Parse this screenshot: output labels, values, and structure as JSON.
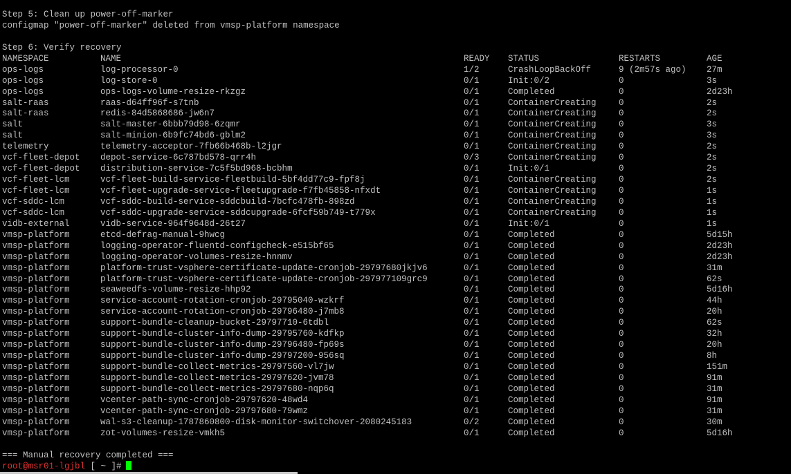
{
  "colors": {
    "background": "#000000",
    "text": "#c0c0c0",
    "prompt_user": "#e03030",
    "cursor": "#00ff00"
  },
  "header_lines": [
    "Step 5: Clean up power-off-marker",
    "configmap \"power-off-marker\" deleted from vmsp-platform namespace",
    "",
    "Step 6: Verify recovery"
  ],
  "table": {
    "columns": [
      "NAMESPACE",
      "NAME",
      "READY",
      "STATUS",
      "RESTARTS",
      "AGE"
    ],
    "rows": [
      [
        "ops-logs",
        "log-processor-0",
        "1/2",
        "CrashLoopBackOff",
        "9 (2m57s ago)",
        "27m"
      ],
      [
        "ops-logs",
        "log-store-0",
        "0/1",
        "Init:0/2",
        "0",
        "3s"
      ],
      [
        "ops-logs",
        "ops-logs-volume-resize-rkzgz",
        "0/1",
        "Completed",
        "0",
        "2d23h"
      ],
      [
        "salt-raas",
        "raas-d64ff96f-s7tnb",
        "0/1",
        "ContainerCreating",
        "0",
        "2s"
      ],
      [
        "salt-raas",
        "redis-84d5868686-jw6n7",
        "0/1",
        "ContainerCreating",
        "0",
        "2s"
      ],
      [
        "salt",
        "salt-master-6bbb79d98-6zqmr",
        "0/1",
        "ContainerCreating",
        "0",
        "3s"
      ],
      [
        "salt",
        "salt-minion-6b9fc74bd6-gblm2",
        "0/1",
        "ContainerCreating",
        "0",
        "3s"
      ],
      [
        "telemetry",
        "telemetry-acceptor-7fb66b468b-l2jgr",
        "0/1",
        "ContainerCreating",
        "0",
        "2s"
      ],
      [
        "vcf-fleet-depot",
        "depot-service-6c787bd578-qrr4h",
        "0/3",
        "ContainerCreating",
        "0",
        "2s"
      ],
      [
        "vcf-fleet-depot",
        "distribution-service-7c5f5bd968-bcbhm",
        "0/1",
        "Init:0/1",
        "0",
        "2s"
      ],
      [
        "vcf-fleet-lcm",
        "vcf-fleet-build-service-fleetbuild-5bf4dd77c9-fpf8j",
        "0/1",
        "ContainerCreating",
        "0",
        "2s"
      ],
      [
        "vcf-fleet-lcm",
        "vcf-fleet-upgrade-service-fleetupgrade-f7fb45858-nfxdt",
        "0/1",
        "ContainerCreating",
        "0",
        "1s"
      ],
      [
        "vcf-sddc-lcm",
        "vcf-sddc-build-service-sddcbuild-7bcfc478fb-898zd",
        "0/1",
        "ContainerCreating",
        "0",
        "1s"
      ],
      [
        "vcf-sddc-lcm",
        "vcf-sddc-upgrade-service-sddcupgrade-6fcf59b749-t779x",
        "0/1",
        "ContainerCreating",
        "0",
        "1s"
      ],
      [
        "vidb-external",
        "vidb-service-964f9648d-26t27",
        "0/1",
        "Init:0/1",
        "0",
        "1s"
      ],
      [
        "vmsp-platform",
        "etcd-defrag-manual-9hwcg",
        "0/1",
        "Completed",
        "0",
        "5d15h"
      ],
      [
        "vmsp-platform",
        "logging-operator-fluentd-configcheck-e515bf65",
        "0/1",
        "Completed",
        "0",
        "2d23h"
      ],
      [
        "vmsp-platform",
        "logging-operator-volumes-resize-hnnmv",
        "0/1",
        "Completed",
        "0",
        "2d23h"
      ],
      [
        "vmsp-platform",
        "platform-trust-vsphere-certificate-update-cronjob-29797680jkjv6",
        "0/1",
        "Completed",
        "0",
        "31m"
      ],
      [
        "vmsp-platform",
        "platform-trust-vsphere-certificate-update-cronjob-297977109grc9",
        "0/1",
        "Completed",
        "0",
        "62s"
      ],
      [
        "vmsp-platform",
        "seaweedfs-volume-resize-hhp92",
        "0/1",
        "Completed",
        "0",
        "5d16h"
      ],
      [
        "vmsp-platform",
        "service-account-rotation-cronjob-29795040-wzkrf",
        "0/1",
        "Completed",
        "0",
        "44h"
      ],
      [
        "vmsp-platform",
        "service-account-rotation-cronjob-29796480-j7mb8",
        "0/1",
        "Completed",
        "0",
        "20h"
      ],
      [
        "vmsp-platform",
        "support-bundle-cleanup-bucket-29797710-6tdbl",
        "0/1",
        "Completed",
        "0",
        "62s"
      ],
      [
        "vmsp-platform",
        "support-bundle-cluster-info-dump-29795760-kdfkp",
        "0/1",
        "Completed",
        "0",
        "32h"
      ],
      [
        "vmsp-platform",
        "support-bundle-cluster-info-dump-29796480-fp69s",
        "0/1",
        "Completed",
        "0",
        "20h"
      ],
      [
        "vmsp-platform",
        "support-bundle-cluster-info-dump-29797200-956sq",
        "0/1",
        "Completed",
        "0",
        "8h"
      ],
      [
        "vmsp-platform",
        "support-bundle-collect-metrics-29797560-vl7jw",
        "0/1",
        "Completed",
        "0",
        "151m"
      ],
      [
        "vmsp-platform",
        "support-bundle-collect-metrics-29797620-jvm78",
        "0/1",
        "Completed",
        "0",
        "91m"
      ],
      [
        "vmsp-platform",
        "support-bundle-collect-metrics-29797680-nqp6q",
        "0/1",
        "Completed",
        "0",
        "31m"
      ],
      [
        "vmsp-platform",
        "vcenter-path-sync-cronjob-29797620-48wd4",
        "0/1",
        "Completed",
        "0",
        "91m"
      ],
      [
        "vmsp-platform",
        "vcenter-path-sync-cronjob-29797680-79wmz",
        "0/1",
        "Completed",
        "0",
        "31m"
      ],
      [
        "vmsp-platform",
        "wal-s3-cleanup-1787860800-disk-monitor-switchover-2080245183",
        "0/2",
        "Completed",
        "0",
        "30m"
      ],
      [
        "vmsp-platform",
        "zot-volumes-resize-vmkh5",
        "0/1",
        "Completed",
        "0",
        "5d16h"
      ]
    ]
  },
  "footer_line": "=== Manual recovery completed ===",
  "prompt": {
    "user_host": "root@msr01-lgjbl",
    "rest": " [ ~ ]#"
  }
}
